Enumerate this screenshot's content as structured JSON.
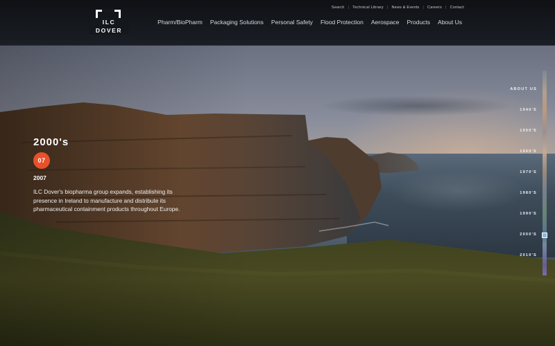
{
  "header": {
    "logo_text": "ILC DOVER",
    "utility_nav": [
      "Search",
      "Technical Library",
      "News & Events",
      "Careers",
      "Contact"
    ],
    "main_nav": [
      "Pharm/BioPharm",
      "Packaging Solutions",
      "Personal Safety",
      "Flood Protection",
      "Aerospace",
      "Products",
      "About Us"
    ]
  },
  "content": {
    "decade": "2000's",
    "badge": "07",
    "year": "2007",
    "description": "ILC Dover's biopharma group expands, establishing its presence in Ireland to manufacture and distribute its pharmaceutical containment products throughout Europe."
  },
  "timeline": {
    "items": [
      "ABOUT US",
      "1940'S",
      "1950'S",
      "1960'S",
      "1970'S",
      "1980'S",
      "1990'S",
      "2000'S",
      "2010'S"
    ],
    "active": "2000'S"
  },
  "colors": {
    "accent": "#e8512a",
    "header_bg": "#14171c"
  }
}
